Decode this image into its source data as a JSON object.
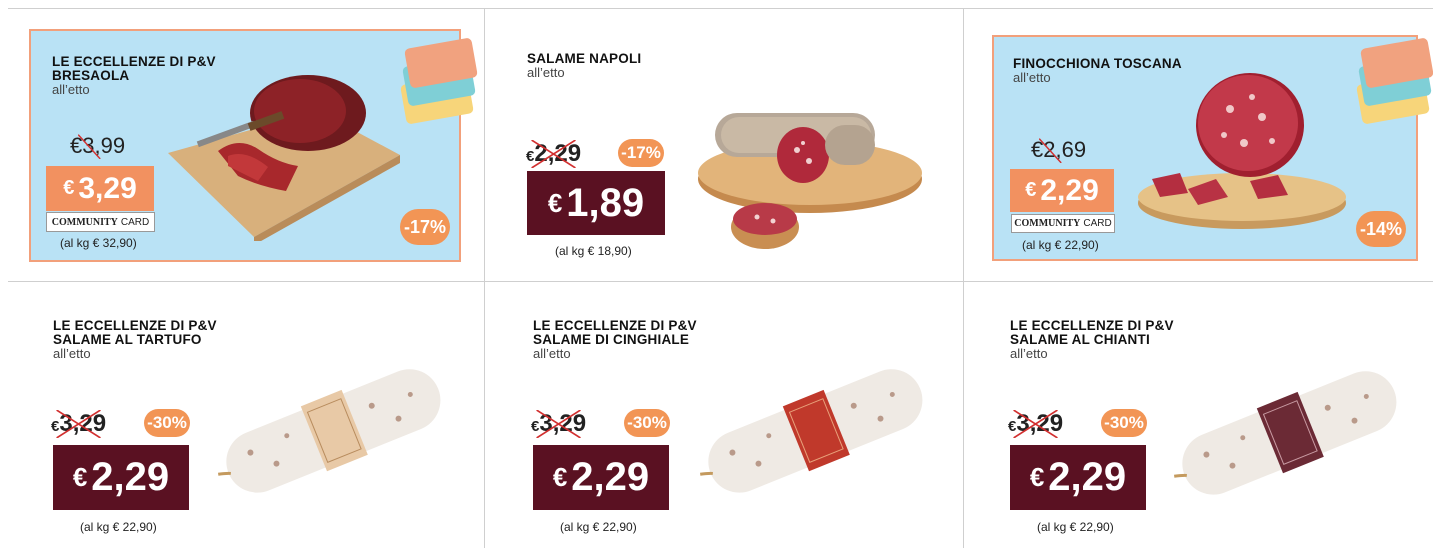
{
  "products": [
    {
      "brand": "LE ECCELLENZE DI P&V",
      "name": "BRESAOLA",
      "unit": "all’etto",
      "old_price": "€3,99",
      "price_euro": "€",
      "price_value": "3,29",
      "discount": "-17%",
      "card_label_bold": "COMMUNITY",
      "card_label_light": "CARD",
      "per_kg": "(al kg € 32,90)",
      "community_card": true
    },
    {
      "brand": "",
      "name": "SALAME NAPOLI",
      "unit": "all’etto",
      "old_price_euro": "€",
      "old_price_value": "2,29",
      "price_euro": "€",
      "price_value": "1,89",
      "discount": "-17%",
      "per_kg": "(al kg € 18,90)",
      "community_card": false
    },
    {
      "brand": "",
      "name": "FINOCCHIONA TOSCANA",
      "unit": "all’etto",
      "old_price": "€2,69",
      "price_euro": "€",
      "price_value": "2,29",
      "discount": "-14%",
      "card_label_bold": "COMMUNITY",
      "card_label_light": "CARD",
      "per_kg": "(al kg € 22,90)",
      "community_card": true
    },
    {
      "brand": "LE ECCELLENZE DI P&V",
      "name": "SALAME AL TARTUFO",
      "unit": "all’etto",
      "old_price_euro": "€",
      "old_price_value": "3,29",
      "price_euro": "€",
      "price_value": "2,29",
      "discount": "-30%",
      "per_kg": "(al kg € 22,90)",
      "community_card": false
    },
    {
      "brand": "LE ECCELLENZE DI P&V",
      "name": "SALAME DI CINGHIALE",
      "unit": "all’etto",
      "old_price_euro": "€",
      "old_price_value": "3,29",
      "price_euro": "€",
      "price_value": "2,29",
      "discount": "-30%",
      "per_kg": "(al kg € 22,90)",
      "community_card": false
    },
    {
      "brand": "LE ECCELLENZE DI P&V",
      "name": "SALAME AL CHIANTI",
      "unit": "all’etto",
      "old_price_euro": "€",
      "old_price_value": "3,29",
      "price_euro": "€",
      "price_value": "2,29",
      "discount": "-30%",
      "per_kg": "(al kg € 22,90)",
      "community_card": false
    }
  ],
  "colors": {
    "price_box": "#5a1122",
    "badge": "#f29555",
    "community_panel": "#b9e2f5",
    "community_border": "#f2a07b",
    "community_price": "#f29160",
    "label_tartufo": "#e8c9a6",
    "label_cinghiale": "#c0392b",
    "label_chianti": "#6b2a35"
  }
}
